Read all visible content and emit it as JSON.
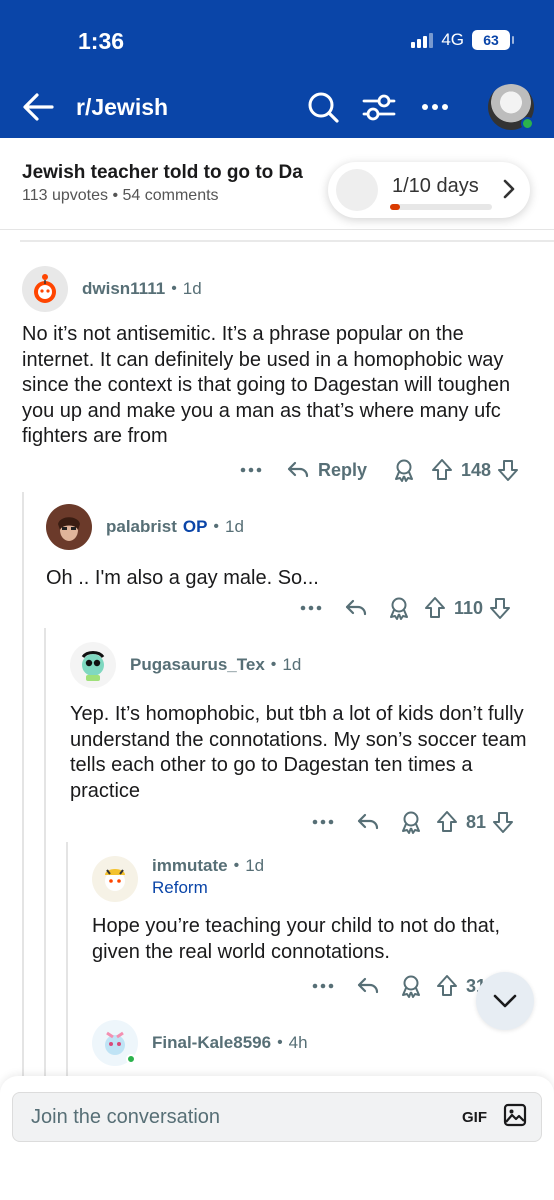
{
  "status": {
    "time": "1:36",
    "network": "4G",
    "battery": "63"
  },
  "nav": {
    "subreddit": "r/Jewish"
  },
  "post": {
    "title": "Jewish teacher told to go to Da",
    "upvotes": "113 upvotes",
    "comments": "54 comments"
  },
  "streak": {
    "label": "1/10 days",
    "progress": 0.1
  },
  "comments": [
    {
      "user": "dwisn1111",
      "op": "",
      "time": "1d",
      "flair": "",
      "body": "No it’s not antisemitic. It’s a phrase popular on the internet. It can definitely be used in a homophobic way since the context is that going to Dagestan will toughen you up and make you a man as that’s where many ufc fighters are from",
      "reply_label": "Reply",
      "score": "148"
    },
    {
      "user": "palabrist",
      "op": "OP",
      "time": "1d",
      "flair": "",
      "body": "Oh .. I'm also a gay male. So...",
      "score": "110"
    },
    {
      "user": "Pugasaurus_Tex",
      "op": "",
      "time": "1d",
      "flair": "",
      "body": "Yep. It’s homophobic, but tbh a lot of kids don’t fully understand the connotations. My son’s soccer team tells each other to go to Dagestan ten times a practice",
      "score": "81"
    },
    {
      "user": "immutate",
      "op": "",
      "time": "1d",
      "flair": "Reform",
      "body": "Hope you’re teaching your child to not do that, given the real world connotations.",
      "score": "31"
    },
    {
      "user": "Final-Kale8596",
      "op": "",
      "time": "4h",
      "flair": "",
      "body": "",
      "score": ""
    }
  ],
  "composer": {
    "placeholder": "Join the conversation",
    "gif_label": "GIF"
  },
  "colors": {
    "header": "#0a45a8",
    "accent": "#0a45a8",
    "meta": "#576f76",
    "progress": "#d93a00"
  }
}
